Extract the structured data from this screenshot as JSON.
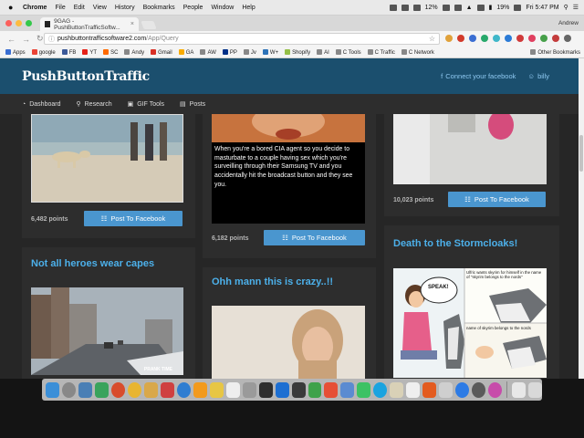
{
  "menubar": {
    "app": "Chrome",
    "items": [
      "File",
      "Edit",
      "View",
      "History",
      "Bookmarks",
      "People",
      "Window",
      "Help"
    ],
    "battery_a": "12%",
    "battery_b": "19%",
    "clock": "Fri 5:47 PM"
  },
  "tab": {
    "title": "9GAG - PushButtonTrafficSoftw..."
  },
  "profile": "Andrew",
  "address": {
    "host": "pushbuttontrafficsoftware2.com",
    "path": "/App/Query"
  },
  "bookmarks": [
    "Apps",
    "google",
    "FB",
    "YT",
    "SC",
    "Andy",
    "Gmail",
    "GA",
    "AW",
    "PP",
    "Jv",
    "W+",
    "Shopify",
    "AI",
    "C Tools",
    "C Traffic",
    "C Network"
  ],
  "bookmarks_other": "Other Bookmarks",
  "site": {
    "logo": "PushButtonTraffic",
    "connect": "Connect your facebook",
    "user": "billy"
  },
  "subnav": [
    "Dashboard",
    "Research",
    "GIF Tools",
    "Posts"
  ],
  "fb_label": "Post To Facebook",
  "cards": {
    "c1": {
      "points": "6,482 points"
    },
    "c2": {
      "points": "6,182 points",
      "caption": "When you're a bored CIA agent so you decide to masturbate to a couple having sex which you're surveilling through their Samsung TV and you accidentally hit the broadcast button and they see you."
    },
    "c3": {
      "points": "10,023 points"
    },
    "c4": {
      "title": "Not all heroes wear capes",
      "watermark": "PRANK TIME"
    },
    "c5": {
      "title": "Ohh mann this is crazy..!!"
    },
    "c6": {
      "title": "Death to the Stormcloaks!",
      "speech": "SPEAK!",
      "comic_top": "Ulfric wants skyrim for himself in the name of \"skyrim belongs to the nords\"",
      "comic_bottom": "name of skyrim belongs to the nords"
    }
  },
  "colors": {
    "accent": "#4cb0ea",
    "header": "#1b4f6e",
    "button": "#4a96cf"
  },
  "icons": [
    "apple-icon",
    "wifi-icon",
    "battery-icon",
    "search-icon",
    "facebook-icon",
    "user-icon",
    "dashboard-icon",
    "gif-icon",
    "posts-icon",
    "calendar-icon"
  ]
}
